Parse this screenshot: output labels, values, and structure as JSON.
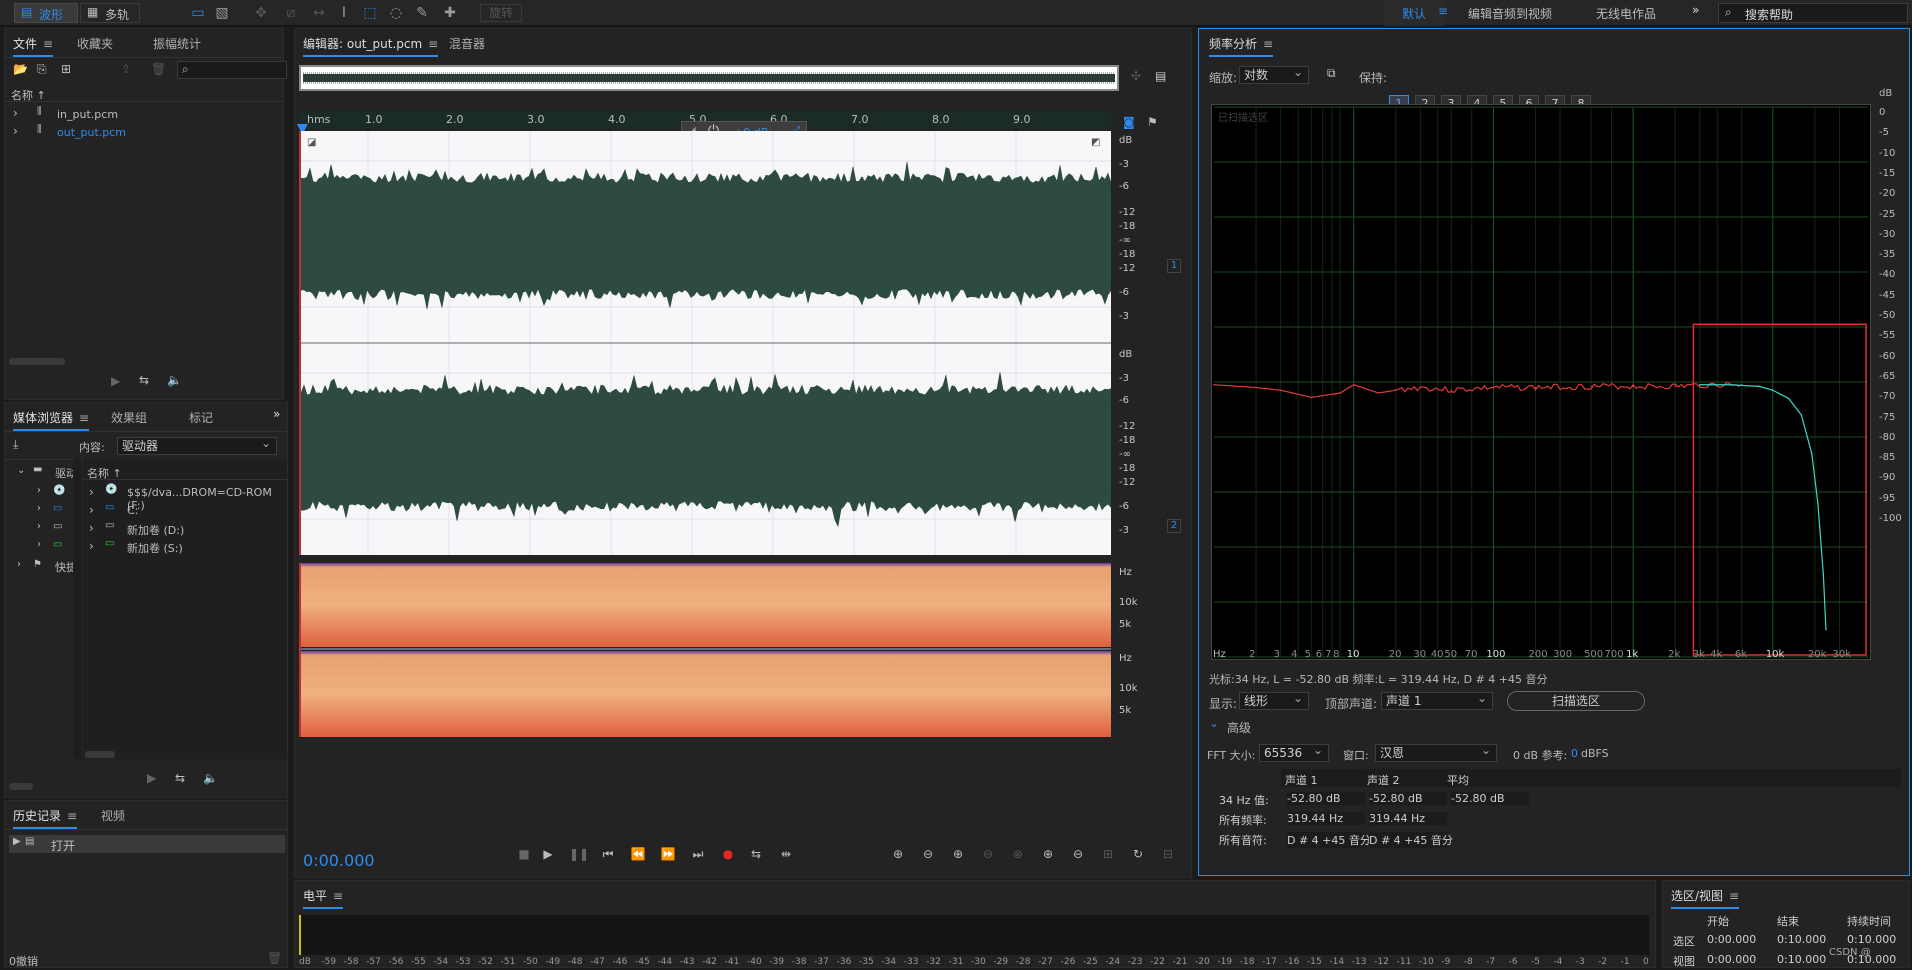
{
  "toolbar": {
    "waveform": "波形",
    "multitrack": "多轨",
    "spin": "旋转",
    "workspaces": [
      "默认",
      "编辑音频到视频",
      "无线电作品"
    ],
    "search_placeholder": "搜索帮助"
  },
  "files_panel": {
    "tabs": [
      "文件",
      "收藏夹",
      "振幅统计"
    ],
    "column": "名称",
    "items": [
      "in_put.pcm",
      "out_put.pcm"
    ]
  },
  "media_panel": {
    "tabs": [
      "媒体浏览器",
      "效果组",
      "标记"
    ],
    "content_label": "内容:",
    "content_value": "驱动器",
    "tree_root": "驱动",
    "tree_quick": "快捷",
    "column": "名称",
    "drives": [
      "$$$/dva...DROM=CD-ROM (F:)",
      "C:",
      "新加卷 (D:)",
      "新加卷 (S:)"
    ]
  },
  "history_panel": {
    "tabs": [
      "历史记录",
      "视频"
    ],
    "item": "打开",
    "undo": "0撤销"
  },
  "editor": {
    "tabs": [
      "编辑器: out_put.pcm",
      "混音器"
    ],
    "ruler_unit": "hms",
    "ruler": [
      "1.0",
      "2.0",
      "3.0",
      "4.0",
      "5.0",
      "6.0",
      "7.0",
      "8.0",
      "9.0"
    ],
    "hud_gain": "+0 dB",
    "db_scale_ch": [
      "dB",
      "-3",
      "-6",
      "-12",
      "-18",
      "-∞",
      "-18",
      "-12",
      "-6",
      "-3"
    ],
    "channel_labels": [
      "1",
      "2"
    ],
    "hz_labels": [
      "Hz",
      "10k",
      "5k"
    ],
    "time": "0:00.000"
  },
  "level_panel": {
    "title": "电平",
    "scale": [
      "dB",
      "-59",
      "-58",
      "-57",
      "-56",
      "-55",
      "-54",
      "-53",
      "-52",
      "-51",
      "-50",
      "-49",
      "-48",
      "-47",
      "-46",
      "-45",
      "-44",
      "-43",
      "-42",
      "-41",
      "-40",
      "-39",
      "-38",
      "-37",
      "-36",
      "-35",
      "-34",
      "-33",
      "-32",
      "-31",
      "-30",
      "-29",
      "-28",
      "-27",
      "-26",
      "-25",
      "-24",
      "-23",
      "-22",
      "-21",
      "-20",
      "-19",
      "-18",
      "-17",
      "-16",
      "-15",
      "-14",
      "-13",
      "-12",
      "-11",
      "-10",
      "-9",
      "-8",
      "-7",
      "-6",
      "-5",
      "-4",
      "-3",
      "-2",
      "-1",
      "0"
    ]
  },
  "selection_panel": {
    "title": "选区/视图",
    "headers": [
      "开始",
      "结束",
      "持续时间"
    ],
    "rows": [
      {
        "label": "选区",
        "start": "0:00.000",
        "end": "0:10.000",
        "dur": "0:10.000"
      },
      {
        "label": "视图",
        "start": "0:00.000",
        "end": "0:10.000",
        "dur": "0:10.000"
      }
    ],
    "watermark": "CSDN @"
  },
  "freq_panel": {
    "title": "频率分析",
    "zoom_label": "缩放:",
    "zoom_value": "对数",
    "hold_label": "保持:",
    "hold_buttons": [
      "1",
      "2",
      "3",
      "4",
      "5",
      "6",
      "7",
      "8"
    ],
    "hold_colors": [
      "#d81d1d",
      "#f08c1c",
      "#f0e01c",
      "#6cd81c",
      "#1cd84a",
      "#1cd8d8",
      "#1c8cf0",
      "#d81cd8"
    ],
    "scan_label": "已扫描选区",
    "x_labels": [
      "Hz",
      "2",
      "3",
      "4",
      "5",
      "6",
      "7",
      "8",
      "10",
      "20",
      "30",
      "40",
      "50",
      "70",
      "100",
      "200",
      "300",
      "500",
      "700",
      "1k",
      "2k",
      "3k",
      "4k",
      "6k",
      "10k",
      "20k",
      "30k"
    ],
    "y_labels": [
      "dB",
      "0",
      "-5",
      "-10",
      "-15",
      "-20",
      "-25",
      "-30",
      "-35",
      "-40",
      "-45",
      "-50",
      "-55",
      "-60",
      "-65",
      "-70",
      "-75",
      "-80",
      "-85",
      "-90",
      "-95",
      "-100"
    ],
    "cursor_info": "光标:34 Hz,   L = -52.80 dB   频率:L = 319.44 Hz,   D # 4 +45 音分",
    "display_label": "显示:",
    "display_value": "线形",
    "top_channel_label": "顶部声道:",
    "top_channel_value": "声道 1",
    "scan_button": "扫描选区",
    "advanced": "高级",
    "fft_label": "FFT 大小:",
    "fft_value": "65536",
    "window_label": "窗口:",
    "window_value": "汉恩",
    "ref_label": "0 dB 参考:",
    "ref_value": "0",
    "ref_unit": "dBFS",
    "table_headers": [
      "声道 1",
      "声道 2",
      "平均"
    ],
    "table_rows": [
      {
        "label": "34 Hz 值:",
        "c1": "-52.80 dB",
        "c2": "-52.80 dB",
        "avg": "-52.80 dB"
      },
      {
        "label": "所有频率:",
        "c1": "319.44 Hz",
        "c2": "319.44 Hz",
        "avg": ""
      },
      {
        "label": "所有音符:",
        "c1": "D # 4 +45 音分",
        "c2": "D # 4 +45 音分",
        "avg": ""
      }
    ]
  },
  "chart_data": {
    "type": "line",
    "xscale": "log",
    "xlim": [
      1,
      48000
    ],
    "ylim": [
      -100,
      0
    ],
    "series": [
      {
        "x": [
          1,
          2,
          3,
          5,
          8,
          10,
          15,
          20,
          30,
          50,
          100,
          200,
          500,
          1000,
          2000,
          3000,
          4000,
          6000
        ],
        "y": [
          -50.5,
          -51,
          -51.5,
          -52.8,
          -52,
          -50.5,
          -52,
          -51.5,
          -51,
          -51.5,
          -51,
          -51,
          -50.8,
          -50.8,
          -50.8,
          -50.6,
          -50.5,
          -50.5
        ]
      },
      {
        "x": [
          3000,
          5000,
          8000,
          10000,
          13000,
          16000,
          19000,
          21000,
          23000,
          24000
        ],
        "y": [
          -50.5,
          -50.5,
          -50.8,
          -51.5,
          -53,
          -56,
          -63,
          -72,
          -85,
          -95
        ]
      }
    ],
    "colors": [
      "#e03a3a",
      "#3ad8c8"
    ],
    "grid": true,
    "selection_box_hz": [
      2700,
      48000
    ]
  }
}
